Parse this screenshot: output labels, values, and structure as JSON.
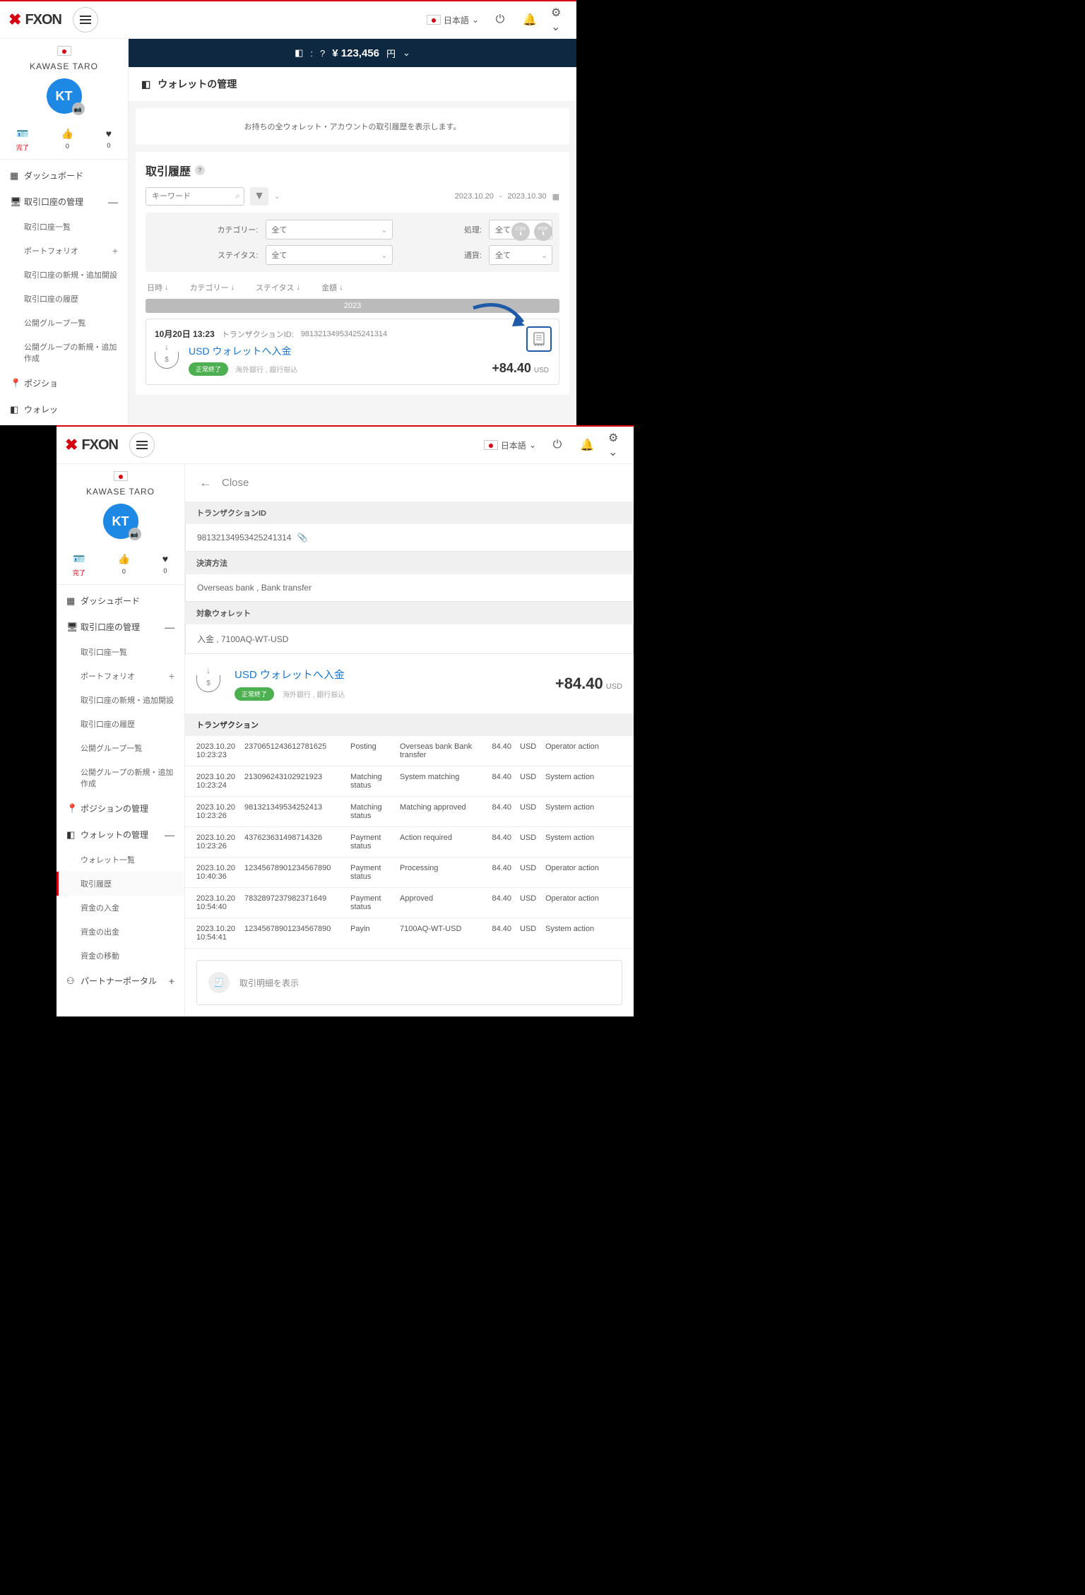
{
  "common": {
    "lang": "日本語",
    "user_name": "KAWASE TARO",
    "avatar": "KT",
    "stats": {
      "done": "完了",
      "like": "0",
      "fav": "0"
    },
    "balance_amount": "¥ 123,456",
    "balance_currency": "円"
  },
  "menu": {
    "dashboard": "ダッシュボード",
    "accounts": "取引口座の管理",
    "acc_list": "取引口座一覧",
    "portfolio": "ポートフォリオ",
    "acc_new": "取引口座の新規・追加開設",
    "acc_history": "取引口座の履歴",
    "group_list": "公開グループ一覧",
    "group_new": "公開グループの新規・追加作成",
    "positions": "ポジションの管理",
    "wallet": "ウォレットの管理",
    "wallet_short": "ウォレッ",
    "wallet_list": "ウォレット一覧",
    "tx_history": "取引履歴",
    "deposit": "資金の入金",
    "withdraw": "資金の出金",
    "transfer": "資金の移動",
    "partner": "パートナーポータル",
    "pos_short": "ポジショ"
  },
  "s1": {
    "page_title": "ウォレットの管理",
    "desc": "お持ちの全ウォレット・アカウントの取引履歴を表示します。",
    "history_title": "取引履歴",
    "search_placeholder": "キーワード",
    "date_from": "2023.10.20",
    "date_to": "2023.10.30",
    "filter": {
      "cat_label": "カテゴリー:",
      "cat_val": "全て",
      "proc_label": "処理:",
      "proc_val": "全て",
      "status_label": "ステイタス:",
      "status_val": "全て",
      "cur_label": "通貨:",
      "cur_val": "全て",
      "csv": "CSV",
      "pdf": "PDF"
    },
    "cols": {
      "dt": "日時",
      "cat": "カテゴリー",
      "st": "ステイタス",
      "amt": "金額"
    },
    "year": "2023",
    "tx": {
      "date": "10月20日",
      "time": "13:23",
      "txid_label": "トランザクションID:",
      "txid": "98132134953425241314",
      "title": "USD ウォレットへ入金",
      "badge": "正常終了",
      "meta": "海外銀行 , 銀行振込",
      "amount": "+84.40",
      "cur": "USD"
    }
  },
  "s2": {
    "close": "Close",
    "txid_label": "トランザクションID",
    "txid": "98132134953425241314",
    "method_label": "決済方法",
    "method": "Overseas bank , Bank transfer",
    "wallet_label": "対象ウォレット",
    "wallet": "入金 , 7100AQ-WT-USD",
    "title": "USD ウォレットへ入金",
    "badge": "正常終了",
    "meta": "海外銀行 , 銀行振込",
    "amount": "+84.40",
    "cur": "USD",
    "table_title": "トランザクション",
    "rows": [
      {
        "t": "2023.10.20 10:23:23",
        "id": "2370651243612781625",
        "s": "Posting",
        "d": "Overseas bank Bank transfer",
        "a": "84.40",
        "c": "USD",
        "o": "Operator action"
      },
      {
        "t": "2023.10.20 10:23:24",
        "id": "213096243102921923",
        "s": "Matching status",
        "d": "System matching",
        "a": "84.40",
        "c": "USD",
        "o": "System action"
      },
      {
        "t": "2023.10.20 10:23:26",
        "id": "98132134953425241​3",
        "s": "Matching status",
        "d": "Matching approved",
        "a": "84.40",
        "c": "USD",
        "o": "System action"
      },
      {
        "t": "2023.10.20 10:23:26",
        "id": "437623631498714326",
        "s": "Payment status",
        "d": "Action required",
        "a": "84.40",
        "c": "USD",
        "o": "System action"
      },
      {
        "t": "2023.10.20 10:40:36",
        "id": "1234567890123456789​0",
        "s": "Payment status",
        "d": "Processing",
        "a": "84.40",
        "c": "USD",
        "o": "Operator action"
      },
      {
        "t": "2023.10.20 10:54:40",
        "id": "7832897237982371649",
        "s": "Payment status",
        "d": "Approved",
        "a": "84.40",
        "c": "USD",
        "o": "Operator action"
      },
      {
        "t": "2023.10.20 10:54:41",
        "id": "1234567890123456789​0",
        "s": "Payin",
        "d": "7100AQ-WT-USD",
        "a": "84.40",
        "c": "USD",
        "o": "System action"
      }
    ],
    "show_detail": "取引明細を表示"
  }
}
